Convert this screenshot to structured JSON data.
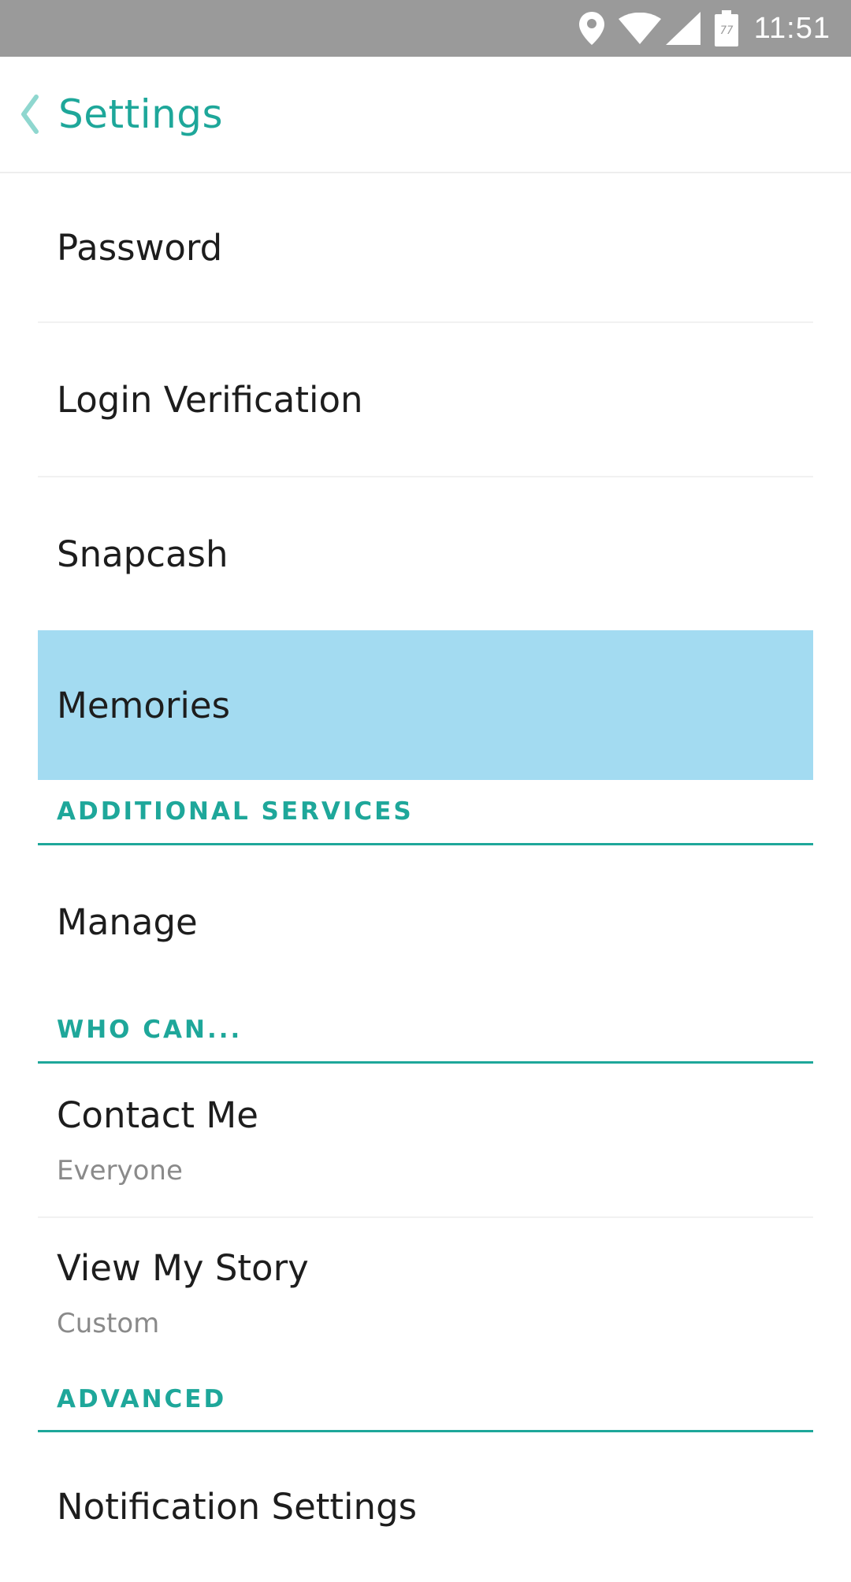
{
  "status_bar": {
    "time": "11:51",
    "battery_level": "77",
    "icons": [
      "location-icon",
      "wifi-icon",
      "signal-icon",
      "battery-icon"
    ]
  },
  "header": {
    "back_icon": "chevron-left-icon",
    "title": "Settings"
  },
  "colors": {
    "accent": "#1ea79a",
    "selected_row": "#a3dbf1",
    "status_bar": "#9a9a9a"
  },
  "items": {
    "password": {
      "label": "Password"
    },
    "login_verification": {
      "label": "Login Verification"
    },
    "snapcash": {
      "label": "Snapcash"
    },
    "memories": {
      "label": "Memories"
    },
    "manage": {
      "label": "Manage"
    },
    "contact_me": {
      "label": "Contact Me",
      "value": "Everyone"
    },
    "view_my_story": {
      "label": "View My Story",
      "value": "Custom"
    },
    "notification_settings": {
      "label": "Notification Settings"
    }
  },
  "sections": {
    "additional_services": "ADDITIONAL SERVICES",
    "who_can": "WHO CAN...",
    "advanced": "ADVANCED"
  }
}
